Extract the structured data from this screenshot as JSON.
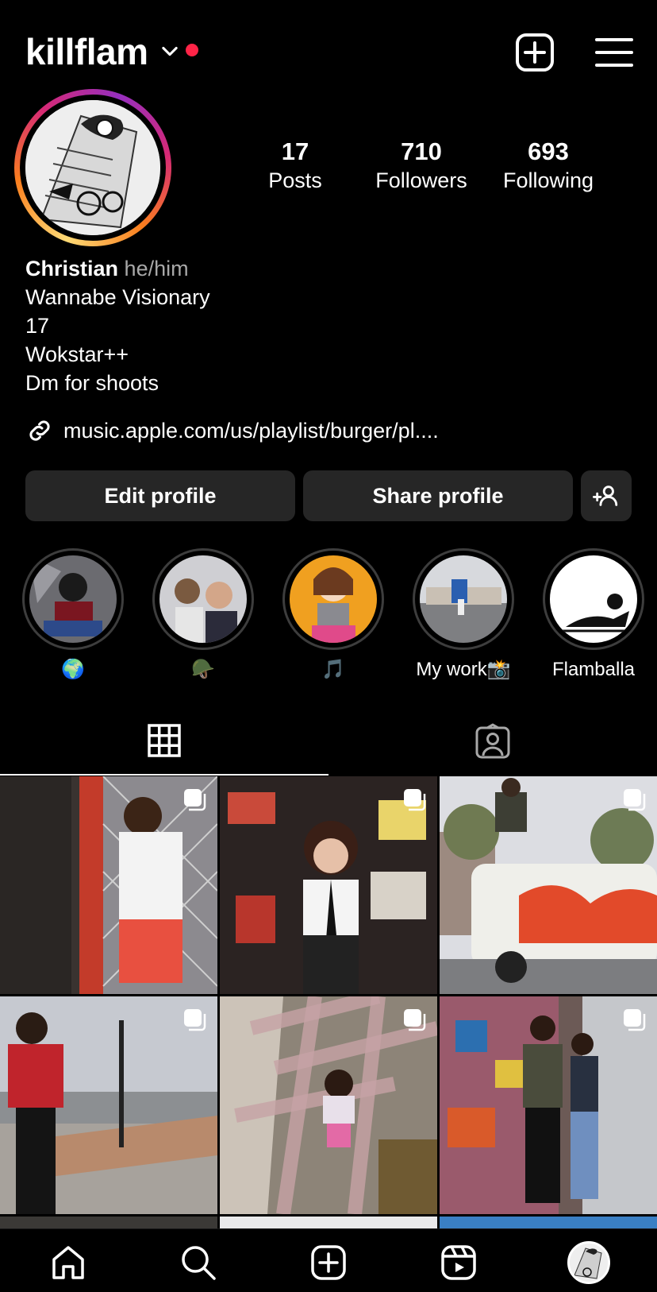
{
  "header": {
    "username": "killflam",
    "notification_dot_color": "#ff2447",
    "icons": [
      "chevron-down-icon",
      "create-icon",
      "menu-icon"
    ]
  },
  "profile": {
    "stats": [
      {
        "value": "17",
        "label": "Posts"
      },
      {
        "value": "710",
        "label": "Followers"
      },
      {
        "value": "693",
        "label": "Following"
      }
    ],
    "name": "Christian",
    "pronouns": "he/him",
    "bio_lines": [
      "Wannabe Visionary",
      "17",
      "Wokstar++",
      "Dm for shoots"
    ],
    "link": "music.apple.com/us/playlist/burger/pl...."
  },
  "buttons": {
    "edit": "Edit profile",
    "share": "Share profile"
  },
  "highlights": [
    {
      "label": "🌍"
    },
    {
      "label": "🪖"
    },
    {
      "label": "🎵"
    },
    {
      "label": "My work📸"
    },
    {
      "label": "Flamballa"
    }
  ],
  "tabs": [
    "grid-icon",
    "tagged-icon"
  ],
  "nav": [
    "home-icon",
    "search-icon",
    "create-icon",
    "reels-icon",
    "profile-avatar"
  ]
}
